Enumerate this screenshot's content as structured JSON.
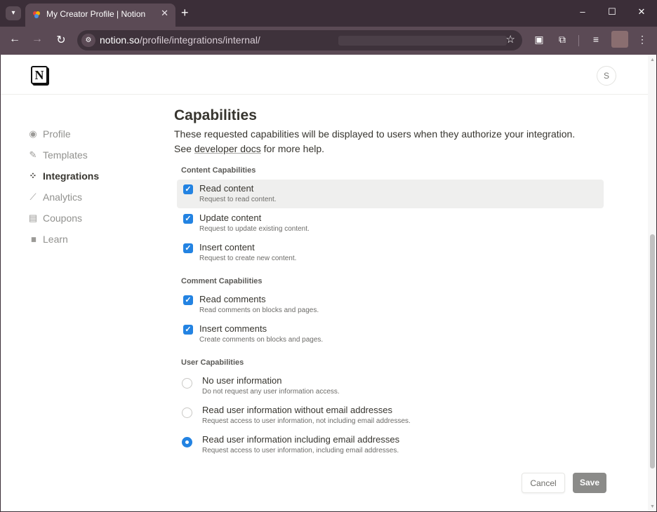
{
  "browser": {
    "tab_title": "My Creator Profile | Notion",
    "tab_close": "✕",
    "new_tab": "+",
    "url_host": "notion.so",
    "url_path": "/profile/integrations/internal/",
    "window": {
      "minimize": "–",
      "maximize": "☐",
      "close": "✕"
    }
  },
  "header": {
    "logo_letter": "N",
    "avatar_initial": "S"
  },
  "sidebar": {
    "items": [
      {
        "label": "Profile",
        "icon": "profile-icon",
        "glyph": "◉",
        "active": false
      },
      {
        "label": "Templates",
        "icon": "templates-icon",
        "glyph": "✎",
        "active": false
      },
      {
        "label": "Integrations",
        "icon": "integrations-icon",
        "glyph": "⁘",
        "active": true
      },
      {
        "label": "Analytics",
        "icon": "analytics-icon",
        "glyph": "⟋",
        "active": false
      },
      {
        "label": "Coupons",
        "icon": "coupons-icon",
        "glyph": "▤",
        "active": false
      },
      {
        "label": "Learn",
        "icon": "learn-icon",
        "glyph": "▮▮",
        "active": false
      }
    ]
  },
  "main": {
    "title": "Capabilities",
    "intro_before": "These requested capabilities will be displayed to users when they authorize your integration. See ",
    "intro_link": "developer docs",
    "intro_after": " for more help.",
    "content_heading": "Content Capabilities",
    "content": [
      {
        "label": "Read content",
        "desc": "Request to read content.",
        "checked": true
      },
      {
        "label": "Update content",
        "desc": "Request to update existing content.",
        "checked": true
      },
      {
        "label": "Insert content",
        "desc": "Request to create new content.",
        "checked": true
      }
    ],
    "comment_heading": "Comment Capabilities",
    "comment": [
      {
        "label": "Read comments",
        "desc": "Read comments on blocks and pages.",
        "checked": true
      },
      {
        "label": "Insert comments",
        "desc": "Create comments on blocks and pages.",
        "checked": true
      }
    ],
    "user_heading": "User Capabilities",
    "user": [
      {
        "label": "No user information",
        "desc": "Do not request any user information access.",
        "selected": false
      },
      {
        "label": "Read user information without email addresses",
        "desc": "Request access to user information, not including email addresses.",
        "selected": false
      },
      {
        "label": "Read user information including email addresses",
        "desc": "Request access to user information, including email addresses.",
        "selected": true
      }
    ],
    "cancel_label": "Cancel",
    "save_label": "Save"
  },
  "colors": {
    "accent": "#2383e2",
    "save_bg": "#8b8b89",
    "browser_frame": "#5b4a55"
  }
}
